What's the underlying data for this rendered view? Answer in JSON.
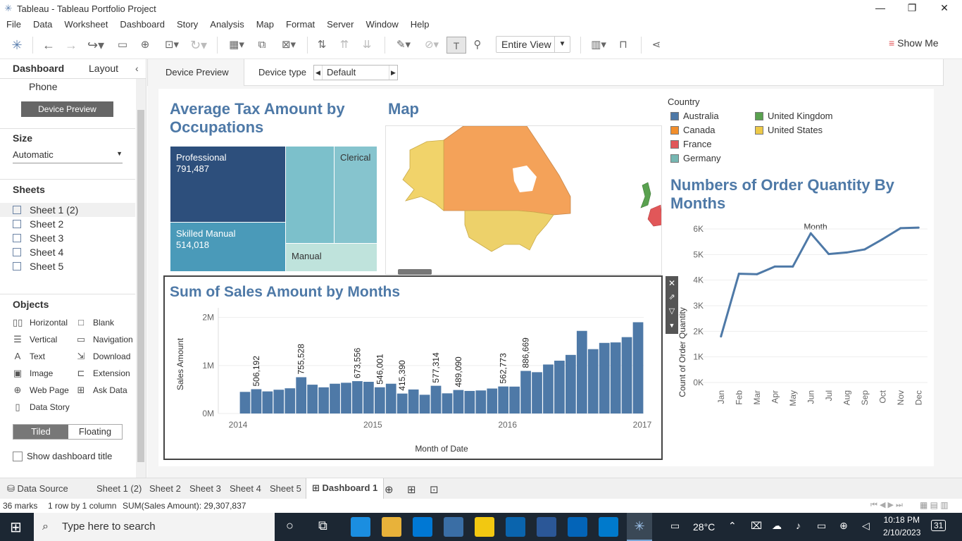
{
  "window": {
    "title": "Tableau - Tableau Portfolio Project"
  },
  "menu": [
    "File",
    "Data",
    "Worksheet",
    "Dashboard",
    "Story",
    "Analysis",
    "Map",
    "Format",
    "Server",
    "Window",
    "Help"
  ],
  "toolbar": {
    "view_dropdown": "Entire View",
    "show_me": "Show Me"
  },
  "left_panel": {
    "tab_dashboard": "Dashboard",
    "tab_layout": "Layout",
    "phone_label": "Phone",
    "device_preview_button": "Device Preview",
    "size_title": "Size",
    "size_value": "Automatic",
    "sheets_title": "Sheets",
    "sheets": [
      "Sheet 1 (2)",
      "Sheet 2",
      "Sheet 3",
      "Sheet 4",
      "Sheet 5"
    ],
    "objects_title": "Objects",
    "objects_left": [
      "Horizontal",
      "Vertical",
      "Text",
      "Image",
      "Web Page",
      "Data Story"
    ],
    "objects_right": [
      "Blank",
      "Navigation",
      "Download",
      "Extension",
      "Ask Data"
    ],
    "tiled": "Tiled",
    "floating": "Floating",
    "show_title": "Show dashboard title"
  },
  "device_bar": {
    "preview": "Device Preview",
    "type_label": "Device type",
    "type_value": "Default"
  },
  "treemap": {
    "title": "Average Tax Amount by Occupations",
    "cells": [
      {
        "name": "Professional",
        "value": "791,487"
      },
      {
        "name": "Skilled Manual",
        "value": "514,018"
      },
      {
        "name": "Clerical",
        "value": ""
      },
      {
        "name": "Manual",
        "value": ""
      }
    ]
  },
  "map": {
    "title": "Map"
  },
  "legend": {
    "title": "Country",
    "items": [
      {
        "name": "Australia",
        "color": "#4e79a7"
      },
      {
        "name": "Canada",
        "color": "#f28e2b"
      },
      {
        "name": "France",
        "color": "#e15759"
      },
      {
        "name": "Germany",
        "color": "#76b7b2"
      },
      {
        "name": "United Kingdom",
        "color": "#59a14f"
      },
      {
        "name": "United States",
        "color": "#edc948"
      }
    ]
  },
  "sales_chart": {
    "title": "Sum of Sales Amount by Months",
    "ylabel": "Sales Amount",
    "xlabel": "Month of Date",
    "yticks": [
      "2M",
      "1M",
      "0M"
    ],
    "xticks": [
      "2014",
      "2015",
      "2016",
      "2017"
    ]
  },
  "order_chart": {
    "title": "Numbers of Order Quantity By Months",
    "header": "Month",
    "ylabel": "Count of Order Quantity",
    "yticks": [
      "6K",
      "5K",
      "4K",
      "3K",
      "2K",
      "1K",
      "0K"
    ],
    "months": [
      "Jan",
      "Feb",
      "Mar",
      "Apr",
      "May",
      "Jun",
      "Jul",
      "Aug",
      "Sep",
      "Oct",
      "Nov",
      "Dec"
    ]
  },
  "chart_data": [
    {
      "type": "bar",
      "title": "Sum of Sales Amount by Months",
      "xlabel": "Month of Date",
      "ylabel": "Sales Amount",
      "ylim": [
        0,
        2200000
      ],
      "values": [
        450000,
        506192,
        460000,
        495000,
        525000,
        755528,
        600000,
        545000,
        620000,
        640000,
        673556,
        660000,
        546001,
        620000,
        415390,
        500000,
        390000,
        577314,
        420000,
        489090,
        470000,
        480000,
        520000,
        562773,
        560000,
        886669,
        860000,
        1020000,
        1100000,
        1220000,
        1720000,
        1340000,
        1470000,
        1480000,
        1590000,
        1900000
      ],
      "labels": [
        "506,192",
        "755,528",
        "673,556",
        "546,001",
        "415,390",
        "577,314",
        "489,090",
        "562,773",
        "886,669"
      ],
      "label_index": [
        1,
        5,
        10,
        12,
        14,
        17,
        19,
        23,
        25
      ]
    },
    {
      "type": "line",
      "title": "Numbers of Order Quantity By Months",
      "xlabel": "Month",
      "ylabel": "Count of Order Quantity",
      "ylim": [
        0,
        6000
      ],
      "categories": [
        "Jan",
        "Feb",
        "Mar",
        "Apr",
        "May",
        "Jun",
        "Jul",
        "Aug",
        "Sep",
        "Oct",
        "Nov",
        "Dec"
      ],
      "values": [
        1800,
        4250,
        4230,
        4530,
        4530,
        5830,
        5020,
        5080,
        5200,
        5600,
        6030,
        6050
      ]
    }
  ],
  "bottom_tabs": [
    "Data Source",
    "Sheet 1 (2)",
    "Sheet 2",
    "Sheet 3",
    "Sheet 4",
    "Sheet 5",
    "Dashboard 1"
  ],
  "status": {
    "marks": "36 marks",
    "rows": "1 row by 1 column",
    "sum": "SUM(Sales Amount): 29,307,837"
  },
  "taskbar": {
    "search": "Type here to search",
    "weather": "28°C",
    "time": "10:18 PM",
    "date": "2/10/2023",
    "notif": "31"
  }
}
